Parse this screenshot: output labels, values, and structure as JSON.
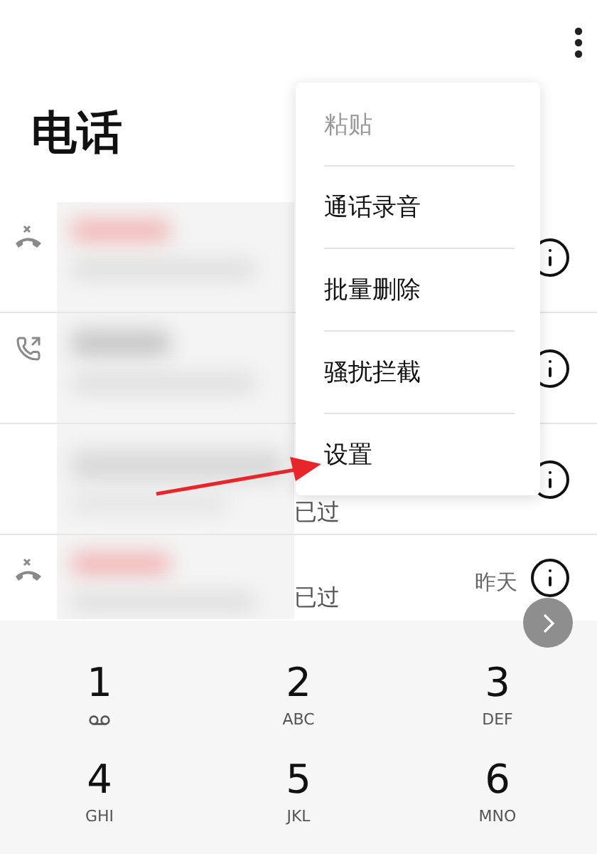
{
  "title": "电话",
  "menu": [
    {
      "label": "粘贴",
      "disabled": true
    },
    {
      "label": "通话录音",
      "disabled": false
    },
    {
      "label": "批量删除",
      "disabled": false
    },
    {
      "label": "骚扰拦截",
      "disabled": false
    },
    {
      "label": "设置",
      "disabled": false
    }
  ],
  "calls": [
    {
      "kind": "missed"
    },
    {
      "kind": "outgoing"
    },
    {
      "kind": "plain",
      "status": "已过"
    },
    {
      "kind": "missed",
      "time": "昨天",
      "status": "已过"
    }
  ],
  "keypad": [
    {
      "digit": "1",
      "kind": "voicemail"
    },
    {
      "digit": "2",
      "kind": "letters",
      "letters": "ABC"
    },
    {
      "digit": "3",
      "kind": "letters",
      "letters": "DEF"
    },
    {
      "digit": "4",
      "kind": "letters",
      "letters": "GHI"
    },
    {
      "digit": "5",
      "kind": "letters",
      "letters": "JKL"
    },
    {
      "digit": "6",
      "kind": "letters",
      "letters": "MNO"
    }
  ]
}
